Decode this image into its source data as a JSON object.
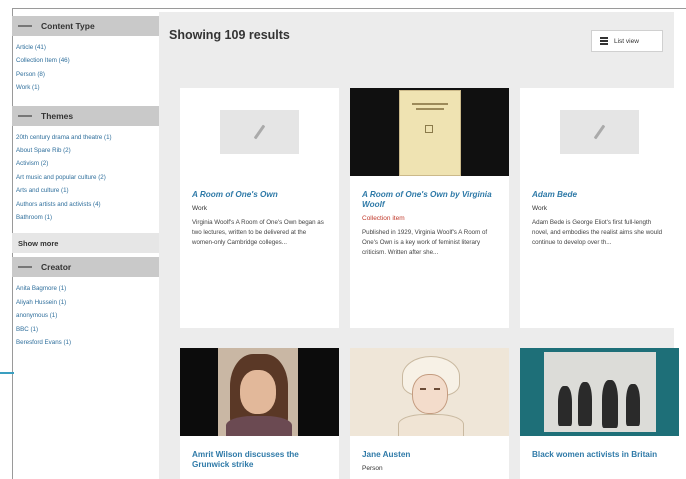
{
  "sidebar": {
    "content_type": {
      "header": "Content Type",
      "items": [
        "Article (41)",
        "Collection Item (46)",
        "Person (8)",
        "Work (1)"
      ]
    },
    "themes": {
      "header": "Themes",
      "items": [
        "20th century drama and theatre (1)",
        "About Spare Rib (2)",
        "Activism (2)",
        "Art music and popular culture (2)",
        "Arts and culture (1)",
        "Authors artists and activists (4)",
        "Bathroom (1)"
      ]
    },
    "show_more": "Show more",
    "creator": {
      "header": "Creator",
      "items": [
        "Anita Bagmore (1)",
        "Aliyah Hussein (1)",
        "anonymous (1)",
        "BBC (1)",
        "Beresford Evans (1)"
      ]
    }
  },
  "main": {
    "results_title": "Showing 109 results",
    "list_view_label": "List view"
  },
  "cards": [
    {
      "title": "A Room of One's Own",
      "type": "Work",
      "description": "Virginia Woolf's A Room of One's Own began as two lectures, written to be delivered at the women-only Cambridge colleges...",
      "media": "placeholder"
    },
    {
      "title": "A Room of One's Own by Virginia Woolf",
      "type": "Collection item",
      "description": "Published in 1929, Virginia Woolf's A Room of One's Own is a key work of feminist literary criticism. Written after she...",
      "media": "book"
    },
    {
      "title": "Adam Bede",
      "type": "Work",
      "description": "Adam Bede is George Eliot's first full-length novel, and embodies the realist aims she would continue to develop over th...",
      "media": "placeholder"
    },
    {
      "title": "Amrit Wilson discusses the Grunwick strike",
      "media": "portrait"
    },
    {
      "title": "Jane Austen",
      "type": "Person",
      "media": "sketch"
    },
    {
      "title": "Black women activists in Britain",
      "media": "group-photo"
    }
  ],
  "colors": {
    "link": "#2f7aa8",
    "facet_header_bg": "#c9c9c9",
    "main_bg": "#ececec",
    "type_accent": "#c0392b",
    "callout": "#3a9fc0"
  },
  "icons": {
    "list_view": "list-icon",
    "placeholder": "pencil-icon",
    "facet_toggle": "minus-icon"
  }
}
